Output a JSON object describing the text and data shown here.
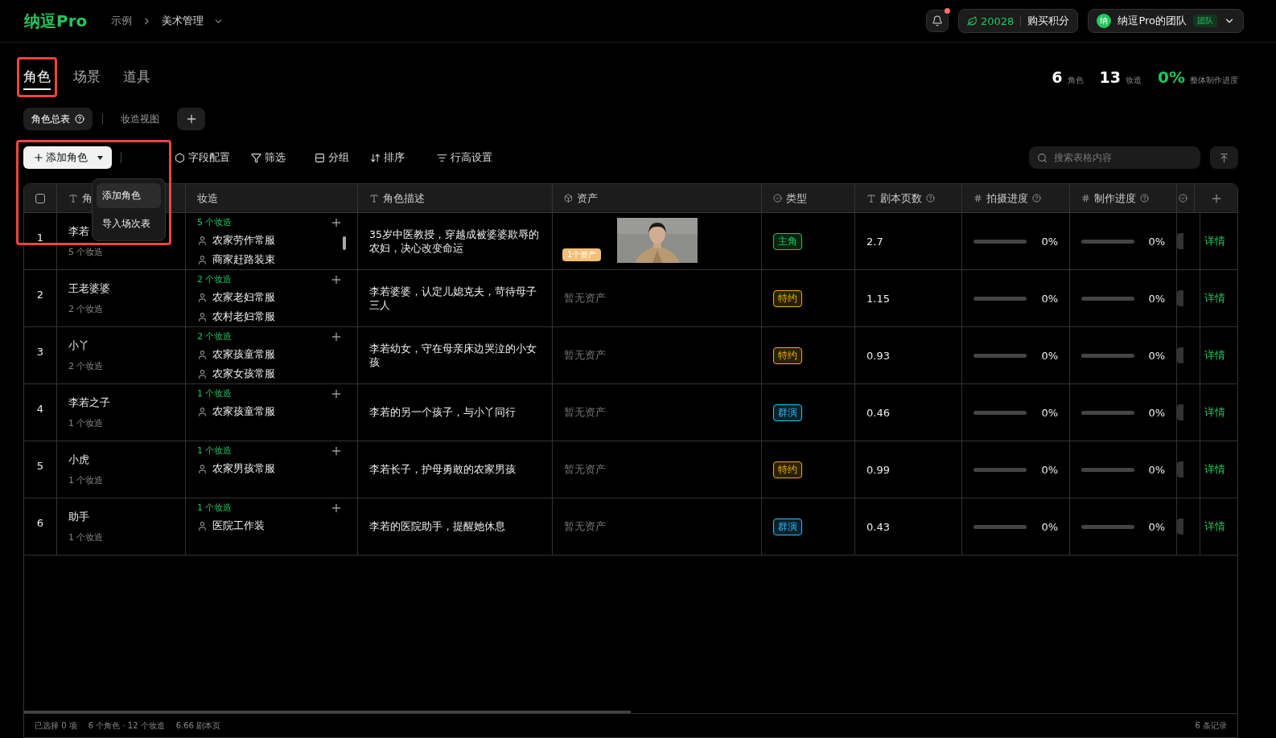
{
  "header": {
    "logo": "纳逗Pro",
    "breadcrumb": [
      "示例",
      "美术管理"
    ],
    "notification_dot": true,
    "points": "20028",
    "buy_points": "购买积分",
    "team": {
      "avatar": "纳",
      "name": "纳逗Pro的团队",
      "badge": "团队"
    }
  },
  "tabs": [
    {
      "label": "角色",
      "selected": true,
      "highlighted": true
    },
    {
      "label": "场景",
      "selected": false,
      "highlighted": false
    },
    {
      "label": "道具",
      "selected": false,
      "highlighted": false
    }
  ],
  "stats": [
    {
      "value": "6",
      "label": "角色",
      "kind": "count"
    },
    {
      "value": "13",
      "label": "妆造",
      "kind": "count"
    },
    {
      "value": "0%",
      "label": "整体制作进度",
      "kind": "percent"
    }
  ],
  "views": [
    {
      "label": "角色总表",
      "selected": true
    },
    {
      "label": "妆造视图",
      "selected": false
    }
  ],
  "toolbar": {
    "add_button": {
      "label": "添加角色",
      "highlighted": true
    },
    "menu": [
      {
        "label": "添加角色",
        "selected": true
      },
      {
        "label": "导入场次表",
        "selected": false
      }
    ],
    "tools": [
      {
        "label": "字段配置",
        "kind": "fields"
      },
      {
        "label": "筛选",
        "kind": "filter"
      },
      {
        "label": "分组",
        "kind": "group"
      },
      {
        "label": "排序",
        "kind": "sort"
      },
      {
        "label": "行高设置",
        "kind": "height"
      }
    ],
    "search_placeholder": "搜索表格内容"
  },
  "table": {
    "select_all": {
      "checked": false
    },
    "columns": [
      {
        "label": "角",
        "kind": "text"
      },
      {
        "label": "妆造",
        "kind": "plain"
      },
      {
        "label": "角色描述",
        "kind": "text"
      },
      {
        "label": "资产",
        "kind": "asset"
      },
      {
        "label": "类型",
        "kind": "select"
      },
      {
        "label": "剧本页数",
        "kind": "text",
        "help": true
      },
      {
        "label": "拍摄进度",
        "kind": "number",
        "help": true
      },
      {
        "label": "制作进度",
        "kind": "number",
        "help": true
      }
    ],
    "rows": [
      {
        "index": "1",
        "name": "李若",
        "costume_count": "5 个妆造",
        "costume_summary": "5 个妆造",
        "costumes": [
          "农家劳作常服",
          "商家赶路装束"
        ],
        "scrollable": true,
        "description": "35岁中医教授，穿越成被婆婆欺辱的农妇，决心改变命运",
        "asset": {
          "kind": "picture",
          "badge": "1个资产"
        },
        "type": {
          "label": "主角",
          "color": "#22c55e"
        },
        "pages": "2.7",
        "shoot": {
          "level": 0,
          "reading": "0%"
        },
        "make": {
          "level": 0,
          "reading": "0%"
        },
        "action": "详情"
      },
      {
        "index": "2",
        "name": "王老婆婆",
        "costume_count": "2 个妆造",
        "costume_summary": "2 个妆造",
        "costumes": [
          "农家老妇常服",
          "农村老妇常服"
        ],
        "scrollable": false,
        "description": "李若婆婆，认定儿媳克夫，苛待母子三人",
        "asset": {
          "kind": "empty",
          "text": "暂无资产"
        },
        "type": {
          "label": "特约",
          "color": "#eab308"
        },
        "pages": "1.15",
        "shoot": {
          "level": 0,
          "reading": "0%"
        },
        "make": {
          "level": 0,
          "reading": "0%"
        },
        "action": "详情"
      },
      {
        "index": "3",
        "name": "小丫",
        "costume_count": "2 个妆造",
        "costume_summary": "2 个妆造",
        "costumes": [
          "农家孩童常服",
          "农家女孩常服"
        ],
        "scrollable": false,
        "description": "李若幼女，守在母亲床边哭泣的小女孩",
        "asset": {
          "kind": "empty",
          "text": "暂无资产"
        },
        "type": {
          "label": "特约",
          "color": "#eab308"
        },
        "pages": "0.93",
        "shoot": {
          "level": 0,
          "reading": "0%"
        },
        "make": {
          "level": 0,
          "reading": "0%"
        },
        "action": "详情"
      },
      {
        "index": "4",
        "name": "李若之子",
        "costume_count": "1 个妆造",
        "costume_summary": "1 个妆造",
        "costumes": [
          "农家孩童常服"
        ],
        "scrollable": false,
        "description": "李若的另一个孩子，与小丫同行",
        "asset": {
          "kind": "empty",
          "text": "暂无资产"
        },
        "type": {
          "label": "群演",
          "color": "#38bdf8"
        },
        "pages": "0.46",
        "shoot": {
          "level": 0,
          "reading": "0%"
        },
        "make": {
          "level": 0,
          "reading": "0%"
        },
        "action": "详情"
      },
      {
        "index": "5",
        "name": "小虎",
        "costume_count": "1 个妆造",
        "costume_summary": "1 个妆造",
        "costumes": [
          "农家男孩常服"
        ],
        "scrollable": false,
        "description": "李若长子，护母勇敢的农家男孩",
        "asset": {
          "kind": "empty",
          "text": "暂无资产"
        },
        "type": {
          "label": "特约",
          "color": "#eab308"
        },
        "pages": "0.99",
        "shoot": {
          "level": 0,
          "reading": "0%"
        },
        "make": {
          "level": 0,
          "reading": "0%"
        },
        "action": "详情"
      },
      {
        "index": "6",
        "name": "助手",
        "costume_count": "1 个妆造",
        "costume_summary": "1 个妆造",
        "costumes": [
          "医院工作装"
        ],
        "scrollable": false,
        "description": "李若的医院助手，提醒她休息",
        "asset": {
          "kind": "empty",
          "text": "暂无资产"
        },
        "type": {
          "label": "群演",
          "color": "#38bdf8"
        },
        "pages": "0.43",
        "shoot": {
          "level": 0,
          "reading": "0%"
        },
        "make": {
          "level": 0,
          "reading": "0%"
        },
        "action": "详情"
      }
    ]
  },
  "footer": {
    "selected": "已选择 0 项",
    "totals": "6 个角色 · 12 个妆造",
    "pages": "6.66 剧本页",
    "records": "6 条记录"
  }
}
